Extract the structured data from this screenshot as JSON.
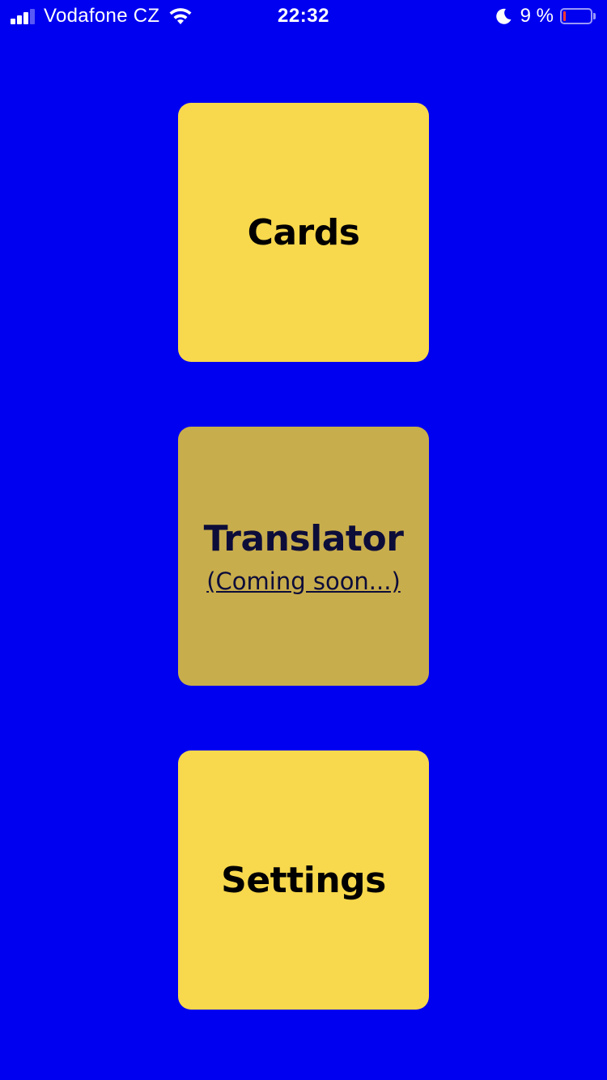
{
  "status_bar": {
    "carrier": "Vodafone CZ",
    "time": "22:32",
    "battery_percent": "9 %",
    "battery_level": 0.09,
    "signal_bars": 3,
    "icons": [
      "signal-icon",
      "wifi-icon",
      "moon-icon",
      "battery-icon"
    ]
  },
  "menu": {
    "cards": {
      "label": "Cards"
    },
    "translator": {
      "label": "Translator",
      "note": "(Coming soon...)"
    },
    "settings": {
      "label": "Settings"
    }
  },
  "colors": {
    "background": "#0000f0",
    "tile": "#f8d84c",
    "tile_disabled": "#c8ad4c",
    "battery_low": "#ff3b30"
  }
}
